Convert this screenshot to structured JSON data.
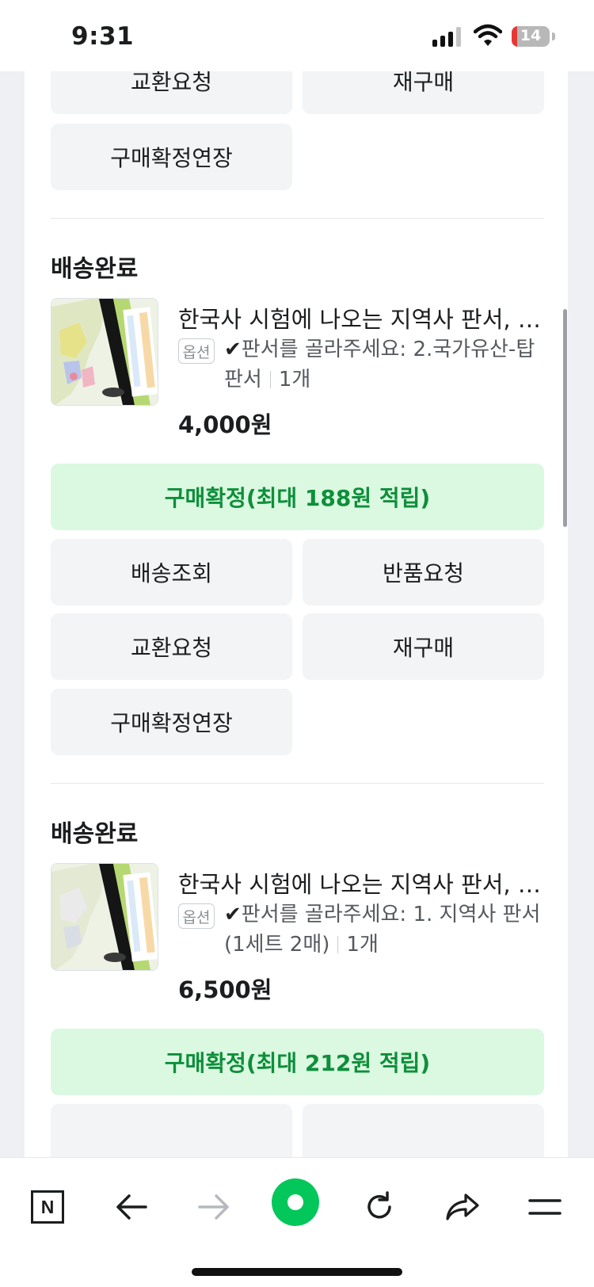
{
  "status_bar": {
    "time": "9:31",
    "battery": "14"
  },
  "top_buttons": {
    "exchange": "교환요청",
    "rebuy": "재구매",
    "extend": "구매확정연장"
  },
  "orders": [
    {
      "status": "배송완료",
      "product_name": "한국사 시험에 나오는 지역사 판서, 국가유산 판서",
      "option_badge": "옵션",
      "option_check": "✔",
      "option_text": "판서를 골라주세요: 2.국가유산-탑 판서",
      "quantity": "1개",
      "price": "4,000원",
      "confirm_label": "구매확정(최대 188원 적립)",
      "buttons": {
        "track": "배송조회",
        "return": "반품요청",
        "exchange": "교환요청",
        "rebuy": "재구매",
        "extend": "구매확정연장"
      }
    },
    {
      "status": "배송완료",
      "product_name": "한국사 시험에 나오는 지역사 판서, 국가유산 판서",
      "option_badge": "옵션",
      "option_check": "✔",
      "option_text": "판서를 골라주세요: 1. 지역사 판서(1세트 2매)",
      "quantity": "1개",
      "price": "6,500원",
      "confirm_label": "구매확정(최대 212원 적립)"
    }
  ],
  "toolbar": {
    "n_label": "N"
  },
  "colors": {
    "accent_green": "#0e8f3a",
    "confirm_bg": "#dbf8e1",
    "button_bg": "#f2f4f6",
    "naver_green": "#03c75a"
  }
}
